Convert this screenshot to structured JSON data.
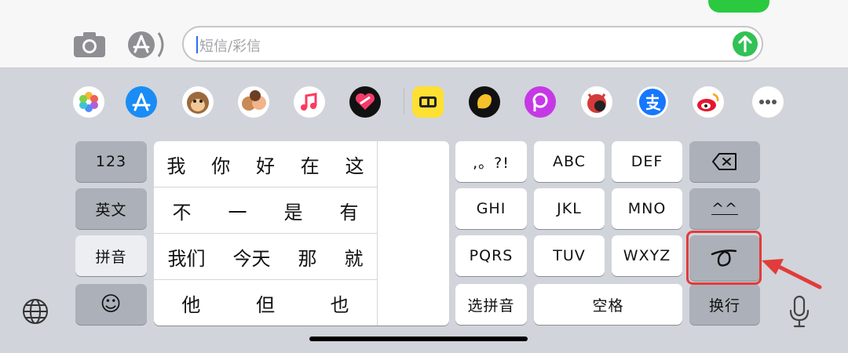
{
  "compose": {
    "placeholder": "短信/彩信"
  },
  "app_strip": [
    {
      "name": "photos-icon",
      "bg": "#ffffff"
    },
    {
      "name": "app-store-icon",
      "bg": "#1a8cf5"
    },
    {
      "name": "monkey-memoji-icon",
      "bg": "#ffffff"
    },
    {
      "name": "memoji-stickers-icon",
      "bg": "#ffffff"
    },
    {
      "name": "music-icon",
      "bg": "#ffffff"
    },
    {
      "name": "digital-touch-icon",
      "bg": "#111111"
    },
    {
      "name": "xianyu-icon",
      "bg": "#ffe033"
    },
    {
      "name": "squirrel-app-icon",
      "bg": "#111111"
    },
    {
      "name": "picsart-icon",
      "bg": "#c638e6"
    },
    {
      "name": "cartoon-app-icon",
      "bg": "#ffffff"
    },
    {
      "name": "alipay-icon",
      "bg": "#ffffff"
    },
    {
      "name": "weibo-icon",
      "bg": "#ffffff"
    },
    {
      "name": "more-apps-icon",
      "bg": "#ffffff"
    }
  ],
  "keyboard": {
    "left_keys": {
      "num": "123",
      "english": "英文",
      "pinyin": "拼音",
      "emoji": "☺"
    },
    "candidates": [
      [
        "我",
        "你",
        "好",
        "在",
        "这"
      ],
      [
        "不",
        "一",
        "是",
        "有"
      ],
      [
        "我们",
        "今天",
        "那",
        "就"
      ],
      [
        "他",
        "但",
        "也"
      ]
    ],
    "t9_keys": {
      "punct": ",。?!",
      "abc": "ABC",
      "def": "DEF",
      "ghi": "GHI",
      "jkl": "JKL",
      "mno": "MNO",
      "pqrs": "PQRS",
      "tuv": "TUV",
      "wxyz": "WXYZ",
      "select_pinyin": "选拼音",
      "space": "空格"
    },
    "right_keys": {
      "kaomoji": "^^",
      "return": "换行"
    }
  },
  "colors": {
    "keyboard_bg": "#d1d4da",
    "highlight": "#e23b3b",
    "send": "#31c154"
  }
}
